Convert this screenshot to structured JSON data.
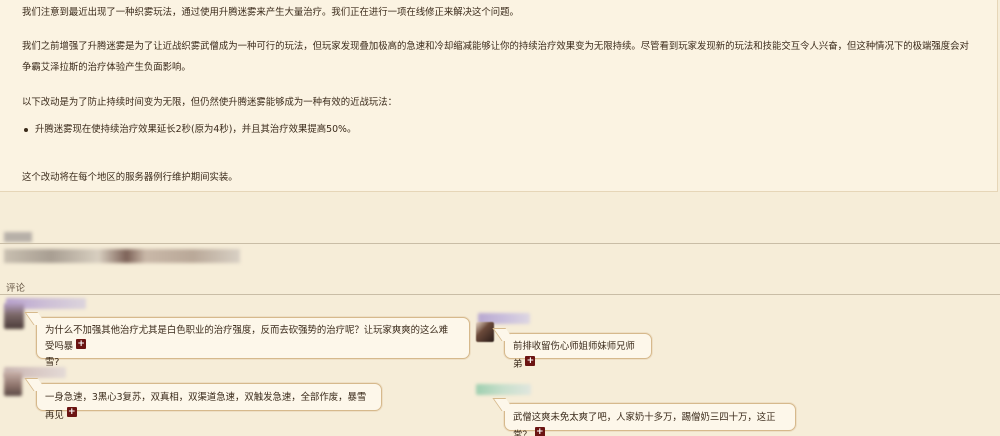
{
  "article": {
    "para1": "我们注意到最近出现了一种织雾玩法，通过使用升腾迷雾来产生大量治疗。我们正在进行一项在线修正来解决这个问题。",
    "para2_line1": "我们之前增强了升腾迷雾是为了让近战织雾武僧成为一种可行的玩法，但玩家发现叠加极高的急速和冷却缩减能够让你的持续治疗效果变为无限持续。尽管看到玩家发现新的玩法和技能交互令人兴奋，但这种情况下的极端强度会对",
    "para2_line2": "争霸艾泽拉斯的治疗体验产生负面影响。",
    "para3": "以下改动是为了防止持续时间变为无限，但仍然使升腾迷雾能够成为一种有效的近战玩法：",
    "bullet1": "升腾迷雾现在使持续治疗效果延长2秒(原为4秒)，并且其治疗效果提高50%。",
    "para4": "这个改动将在每个地区的服务器例行维护期间实装。"
  },
  "comments_section": {
    "title": "评论"
  },
  "comments": [
    {
      "text_line1": "为什么不加强其他治疗尤其是白色职业的治疗强度，反而去砍强势的治疗呢？让玩家爽爽的这么难受吗暴",
      "text_line2": "雪?",
      "plus": "+"
    },
    {
      "text": "前排收留伤心师姐师妹师兄师弟",
      "plus": "+"
    },
    {
      "text": "一身急速，3黑心3复苏，双真相，双渠道急速，双触发急速，全部作废，暴雪再见",
      "plus": "+"
    },
    {
      "text": "武僧这爽未免太爽了吧，人家奶十多万，踢僧奶三四十万，这正常？",
      "plus": "+"
    }
  ],
  "colors": {
    "background": "#f6edd8",
    "article_bg": "#fbf3e2",
    "bubble_border": "#d6b98c",
    "plus_badge": "#6b1412"
  }
}
